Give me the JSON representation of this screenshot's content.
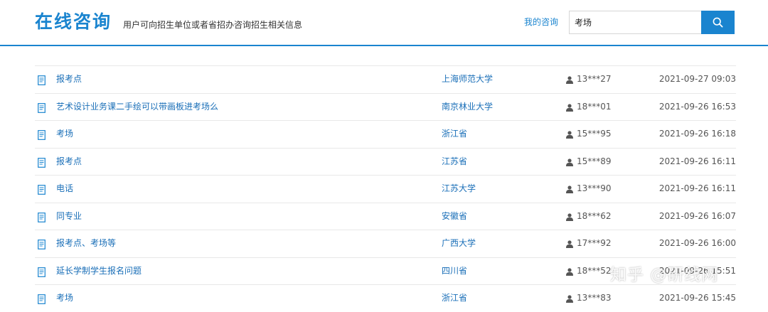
{
  "header": {
    "title": "在线咨询",
    "subtitle": "用户可向招生单位或者省招办咨询招生相关信息",
    "my_consult_label": "我的咨询",
    "search_value": "考场",
    "search_icon": "search-icon"
  },
  "colors": {
    "accent": "#1a84cf",
    "link": "#1a6fb8",
    "muted": "#555555"
  },
  "rows": [
    {
      "title": "报考点",
      "school": "上海师范大学",
      "user": "13***27",
      "time": "2021-09-27 09:03"
    },
    {
      "title": "艺术设计业务课二手绘可以带画板进考场么",
      "school": "南京林业大学",
      "user": "18***01",
      "time": "2021-09-26 16:53"
    },
    {
      "title": "考场",
      "school": "浙江省",
      "user": "15***95",
      "time": "2021-09-26 16:18"
    },
    {
      "title": "报考点",
      "school": "江苏省",
      "user": "15***89",
      "time": "2021-09-26 16:11"
    },
    {
      "title": "电话",
      "school": "江苏大学",
      "user": "13***90",
      "time": "2021-09-26 16:11"
    },
    {
      "title": "同专业",
      "school": "安徽省",
      "user": "18***62",
      "time": "2021-09-26 16:07"
    },
    {
      "title": "报考点、考场等",
      "school": "广西大学",
      "user": "17***92",
      "time": "2021-09-26 16:00"
    },
    {
      "title": "延长学制学生报名问题",
      "school": "四川省",
      "user": "18***52",
      "time": "2021-09-26 15:51"
    },
    {
      "title": "考场",
      "school": "浙江省",
      "user": "13***83",
      "time": "2021-09-26 15:45"
    }
  ],
  "watermark": "知乎 @研线网"
}
